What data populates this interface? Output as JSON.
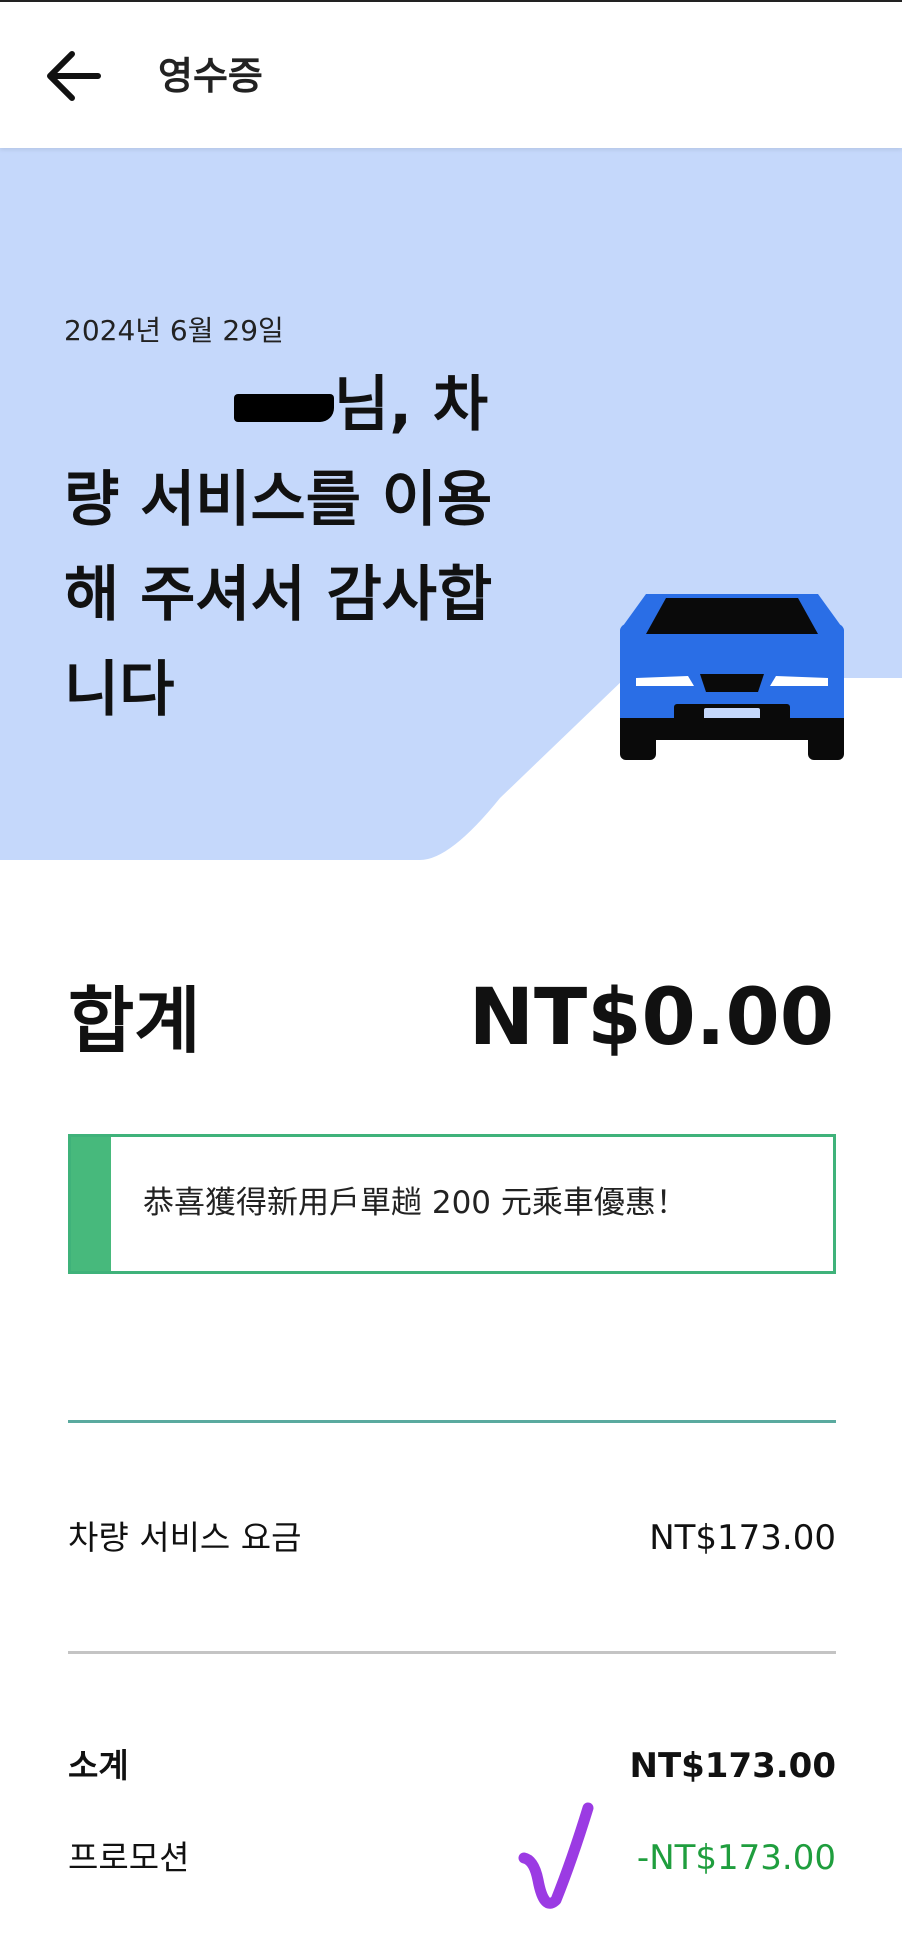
{
  "header": {
    "title": "영수증",
    "back_icon": "arrow-left-icon"
  },
  "hero": {
    "date": "2024년 6월 29일",
    "greeting": "님, 차량 서비스를 이용해 주셔서 감사합니다",
    "illustration": "car-icon",
    "background_color": "#c5d8fb",
    "car_color": "#2a6ee6"
  },
  "total": {
    "label": "합계",
    "value": "NT$0.00"
  },
  "promo_banner": {
    "text": "恭喜獲得新用戶單趟 200 元乘車優惠！",
    "accent_color": "#47b97c"
  },
  "line_items": [
    {
      "label": "차량 서비스 요금",
      "value": "NT$173.00"
    }
  ],
  "summary": {
    "subtotal_label": "소계",
    "subtotal_value": "NT$173.00",
    "promotion_label": "프로모션",
    "promotion_value": "-NT$173.00",
    "promotion_color": "#1f9e3e"
  },
  "annotation": {
    "checkmark_icon": "checkmark-icon",
    "color": "#9b3be3"
  }
}
